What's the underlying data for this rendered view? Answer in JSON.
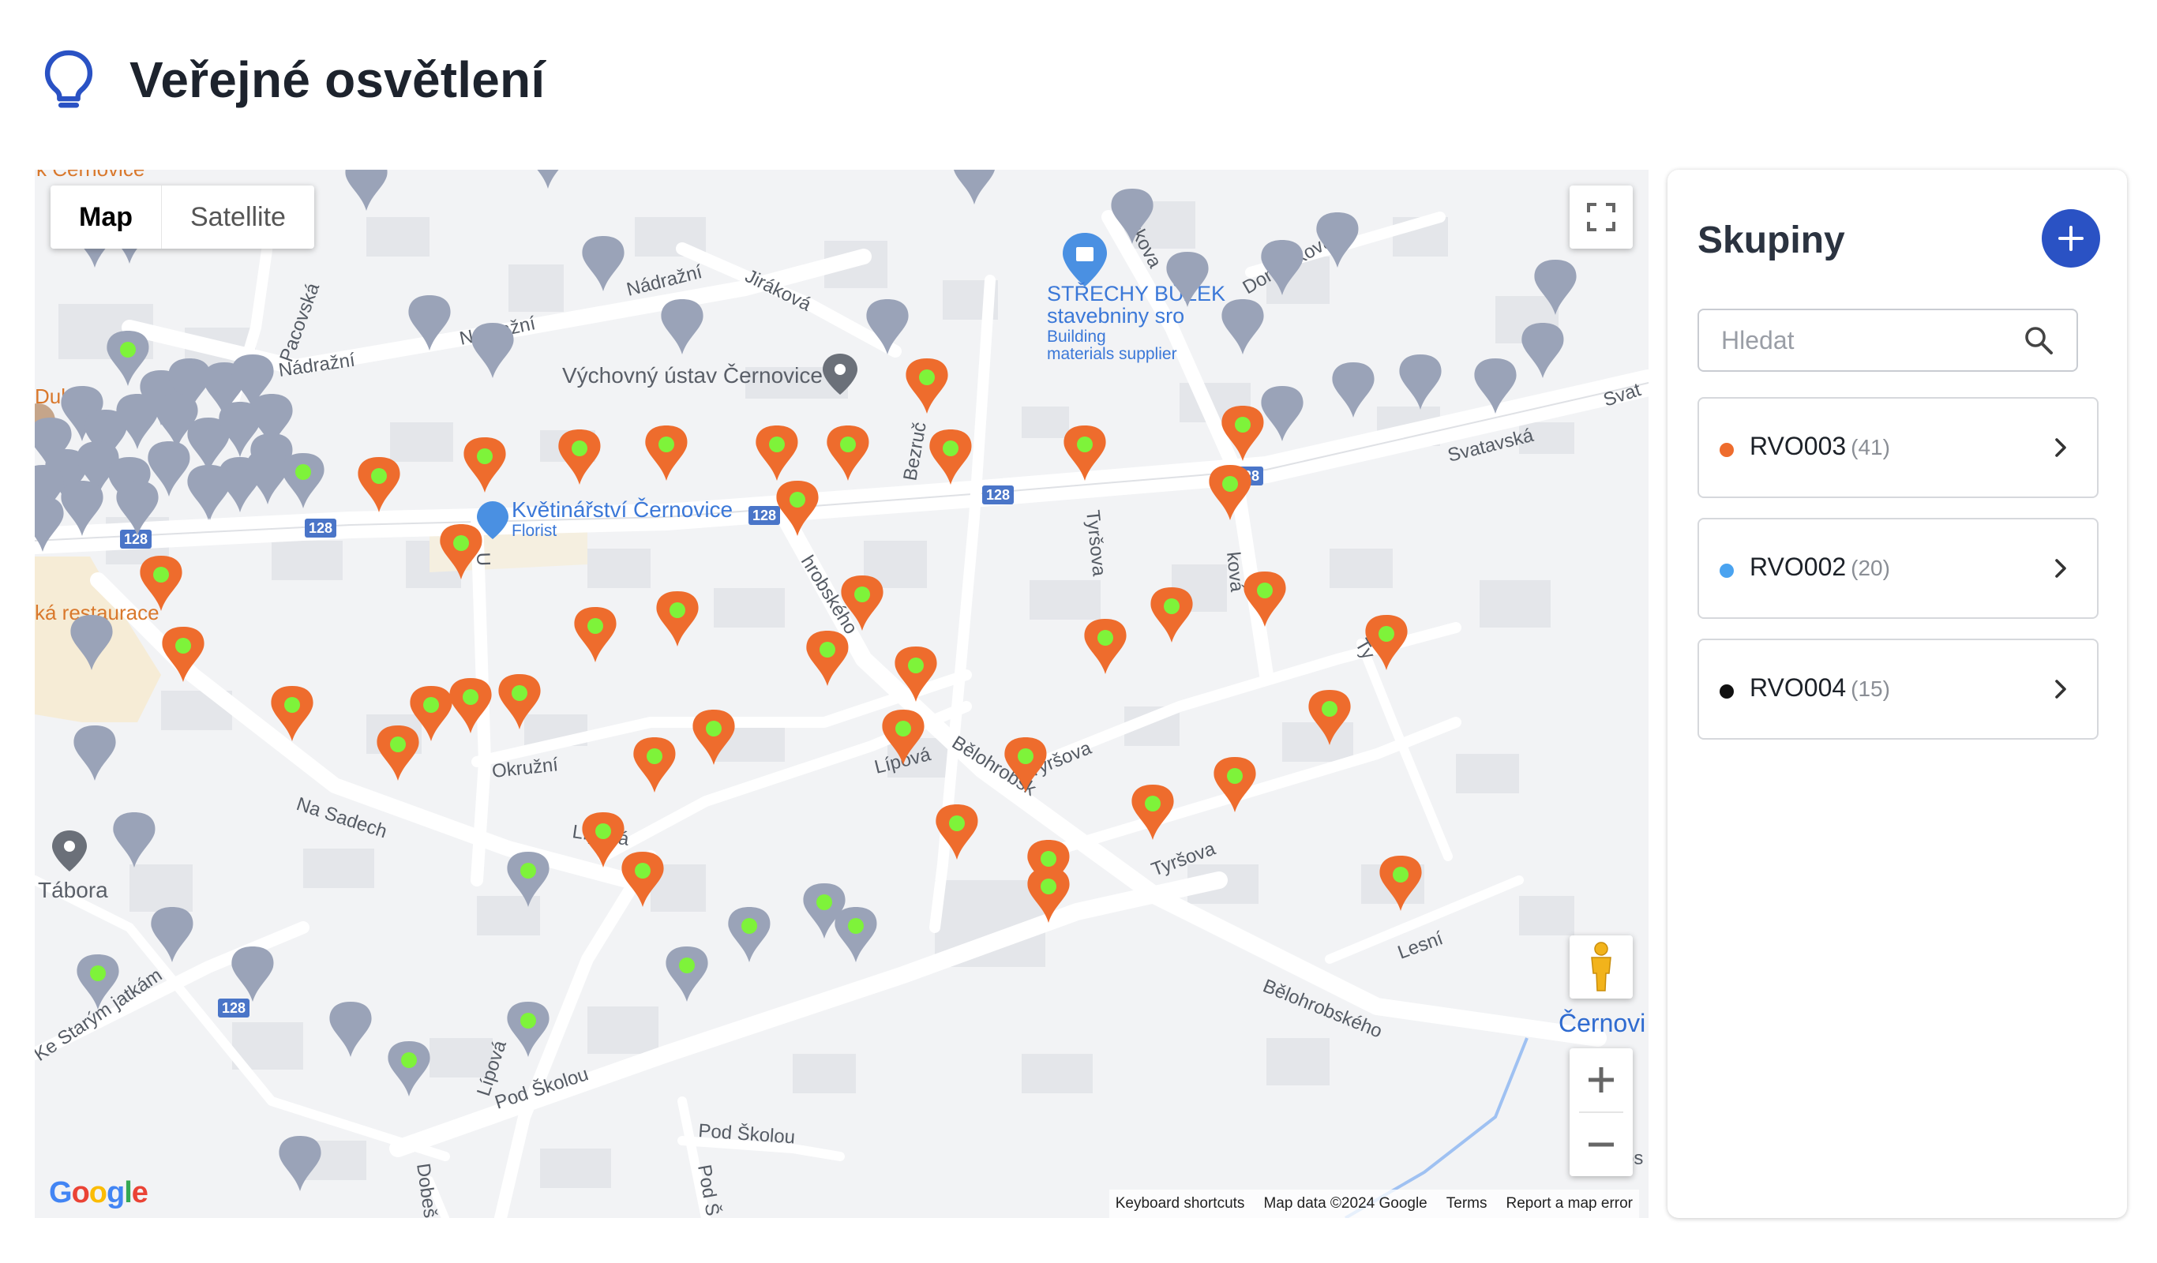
{
  "header": {
    "title": "Veřejné osvětlení",
    "icon": "lightbulb-icon",
    "icon_color": "#2a52c4"
  },
  "map": {
    "type_control": {
      "map_label": "Map",
      "satellite_label": "Satellite",
      "active": "Map"
    },
    "places": [
      {
        "name": "Květinářství Černovice",
        "sub": "Florist"
      },
      {
        "name": "STŘECHY BŮŽEK",
        "line2": "stavebniny sro",
        "sub1": "Building",
        "sub2": "materials supplier"
      },
      {
        "name": "Výchovný ústav Černovice"
      },
      {
        "name": "Tábora"
      },
      {
        "name": "Černovi"
      }
    ],
    "edge_labels": [
      "k Černovice",
      "Dubu",
      "ká restaurace"
    ],
    "streets": [
      "Nádražní",
      "Nádražní",
      "Nádražní",
      "Jiráková",
      "Lhotkova",
      "Domečkova",
      "Pacovská",
      "Svatavská",
      "Svat",
      "Bezruč",
      "Tyršova",
      "Tyršova",
      "Tyršova",
      "Bělohrobského",
      "Bělohrobsk",
      "Bělohrobského",
      "Okružní",
      "Na Sadech",
      "Lípová",
      "Lípová",
      "Lípová",
      "Pod Školou",
      "Pod Školou",
      "Pod Š",
      "Lesní",
      "Ke Starým jatkám",
      "Dobeš",
      "hrobského",
      "U",
      "ková",
      "Ty",
      "bs"
    ],
    "road_shields": [
      "128",
      "128",
      "128",
      "128",
      "128",
      "128"
    ],
    "attribution": {
      "shortcuts": "Keyboard shortcuts",
      "data": "Map data ©2024 Google",
      "terms": "Terms",
      "report": "Report a map error"
    },
    "logo_letters": [
      "G",
      "o",
      "o",
      "g",
      "l",
      "e"
    ],
    "colors": {
      "marker_active": "#ee6c2d",
      "marker_inactive": "#9aa3b8",
      "marker_dot": "#7ef33a"
    }
  },
  "panel": {
    "title": "Skupiny",
    "add_icon": "plus-icon",
    "search_placeholder": "Hledat",
    "search_icon": "search-icon",
    "groups": [
      {
        "name": "RVO003",
        "count": "(41)",
        "color": "#ee6c2d"
      },
      {
        "name": "RVO002",
        "count": "(20)",
        "color": "#4aa3f0"
      },
      {
        "name": "RVO004",
        "count": "(15)",
        "color": "#111111"
      }
    ]
  }
}
